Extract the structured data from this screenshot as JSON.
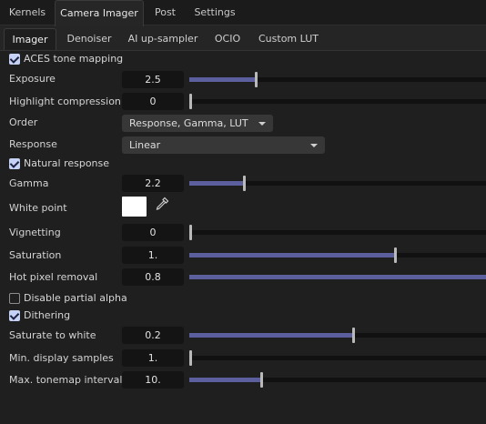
{
  "main_tabs": [
    "Kernels",
    "Camera Imager",
    "Post",
    "Settings"
  ],
  "sub_tabs": [
    "Imager",
    "Denoiser",
    "AI up-sampler",
    "OCIO",
    "Custom LUT"
  ],
  "aces": {
    "label": "ACES tone mapping",
    "checked": true
  },
  "exposure": {
    "label": "Exposure",
    "value": "2.5",
    "fraction": 0.22
  },
  "highlight": {
    "label": "Highlight compression",
    "value": "0",
    "fraction": 0.0
  },
  "order": {
    "label": "Order",
    "value": "Response, Gamma, LUT"
  },
  "response": {
    "label": "Response",
    "value": "Linear"
  },
  "natural": {
    "label": "Natural response",
    "checked": true
  },
  "gamma": {
    "label": "Gamma",
    "value": "2.2",
    "fraction": 0.18
  },
  "white_point": {
    "label": "White point",
    "color": "#ffffff",
    "picker_icon": "eyedropper-icon"
  },
  "vignetting": {
    "label": "Vignetting",
    "value": "0",
    "fraction": 0.0
  },
  "saturation": {
    "label": "Saturation",
    "value": "1.",
    "fraction": 0.69
  },
  "hot_pixel": {
    "label": "Hot pixel removal",
    "value": "0.8",
    "fraction": 1.0
  },
  "partial_alpha": {
    "label": "Disable partial alpha",
    "checked": false
  },
  "dithering": {
    "label": "Dithering",
    "checked": true
  },
  "sat_white": {
    "label": "Saturate to white",
    "value": "0.2",
    "fraction": 0.55
  },
  "min_samples": {
    "label": "Min. display samples",
    "value": "1.",
    "fraction": 0.0
  },
  "max_tonemap": {
    "label": "Max. tonemap interval",
    "value": "10.",
    "fraction": 0.24
  },
  "colors": {
    "accent": "#5b5f9e",
    "checkbox": "#c6d2f5"
  }
}
